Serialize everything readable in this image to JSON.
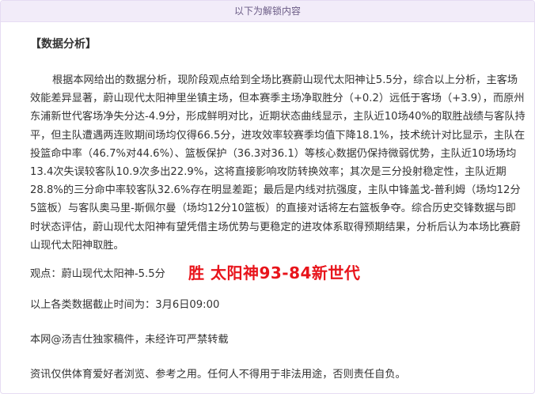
{
  "unlock_bar": {
    "text": "以下为解锁内容"
  },
  "article": {
    "section_title": "【数据分析】",
    "body": "根据本网给出的数据分析，现阶段观点给到全场比赛蔚山现代太阳神让5.5分，综合以上分析，主客场效能差异显著，蔚山现代太阳神里坐镇主场，但本赛季主场净取胜分（+0.2）远低于客场（+3.9），而原州东浦新世代客场净失分达-4.9分，形成鲜明对比，近期状态曲线显示，主队近10场40%的取胜战绩与客队持平，但主队遭遇两连败期间场均仅得66.5分，进攻效率较赛季均值下降18.1%，技术统计对比显示，主队在投篮命中率（46.7%对44.6%）、篮板保护（36.3对36.1）等核心数据仍保持微弱优势，主队近10场场均13.4次失误较客队10.9次多出22.9%，这将直接影响攻防转换效率；其次是三分投射稳定性，主队近期28.8%的三分命中率较客队32.6%存在明显差距；最后是内线对抗强度，主队中锋盖戈-普利姆（场均12分5篮板）与客队奥马里-斯佩尔曼（场均12分10篮板）的直接对话将左右篮板争夺。综合历史交锋数据与即时状态评估，蔚山现代太阳神有望凭借主场优势与更稳定的进攻体系取得预期结果，分析后认为本场比赛蔚山现代太阳神取胜。",
    "view_label": "观点：蔚山现代太阳神-5.5分",
    "result": "胜  太阳神93-84新世代",
    "deadline": "以上各类数据截止时间为：3月6日09:00",
    "copyright": "本网@汤吉仕独家稿件，未经许可严禁转载",
    "disclaimer": "资讯仅供体育爱好者浏览、参考之用。任何人不得用于非法用途，否则责任自负。"
  }
}
